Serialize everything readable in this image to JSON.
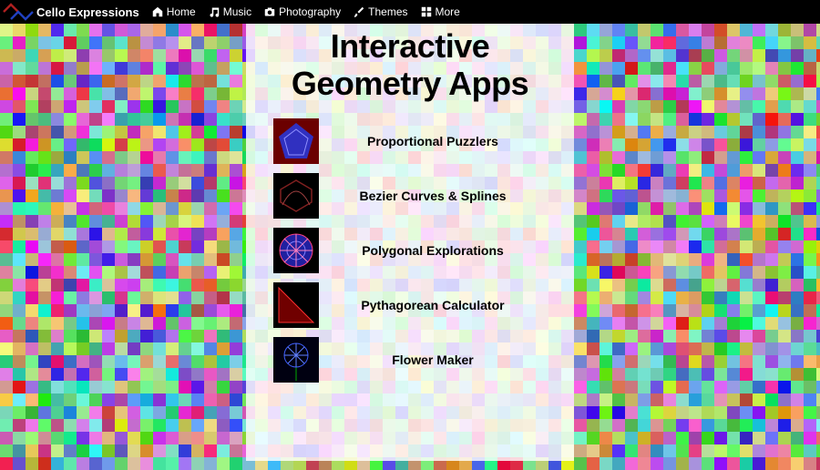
{
  "brand": "Cello Expressions",
  "nav": [
    {
      "icon": "home",
      "label": "Home"
    },
    {
      "icon": "music",
      "label": "Music"
    },
    {
      "icon": "camera",
      "label": "Photography"
    },
    {
      "icon": "brush",
      "label": "Themes"
    },
    {
      "icon": "grid",
      "label": "More"
    }
  ],
  "title_line1": "Interactive",
  "title_line2": "Geometry Apps",
  "apps": [
    {
      "name": "Proportional Puzzlers"
    },
    {
      "name": "Bezier Curves & Splines"
    },
    {
      "name": "Polygonal Explorations"
    },
    {
      "name": "Pythagorean Calculator"
    },
    {
      "name": "Flower Maker"
    }
  ]
}
